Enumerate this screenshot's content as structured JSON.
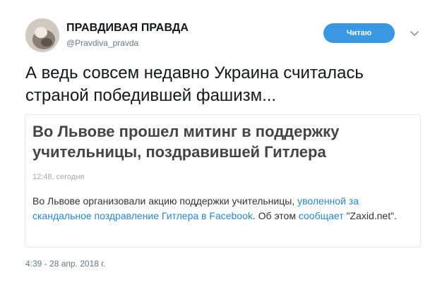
{
  "author": {
    "name": "ПРАВДИВАЯ ПРАВДА",
    "handle": "@Pravdiva_pravda"
  },
  "follow_button": {
    "label": "Читаю"
  },
  "icons": {
    "avatar": "avatar-image",
    "more": "chevron-down-icon"
  },
  "tweet": {
    "text": "А ведь совсем недавно Украина считалась страной победившей фашизм...",
    "timestamp": "4:39 - 28 апр. 2018 г."
  },
  "card": {
    "title": "Во Львове прошел митинг в поддержку учительницы, поздравившей Гитлера",
    "time": "12:48, сегодня",
    "body_part1": "Во Львове организовали акцию поддержки учительницы, ",
    "body_link1": "уволенной за скандальное поздравление Гитлера в Facebook",
    "body_part2": ". Об этом ",
    "body_link2": "сообщает",
    "body_part3": " \"Zaxid.net\"."
  },
  "colors": {
    "accent": "#3a98e3",
    "link": "#2a86c9",
    "muted": "#657786"
  }
}
